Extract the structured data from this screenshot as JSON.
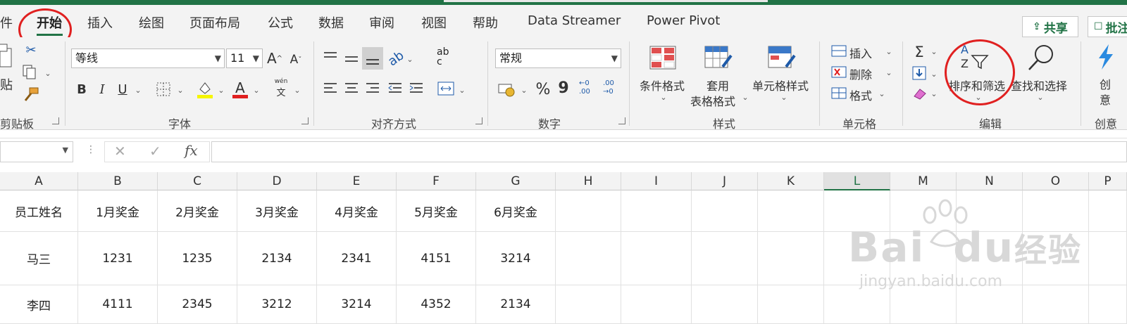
{
  "tabs": [
    "件",
    "开始",
    "插入",
    "绘图",
    "页面布局",
    "公式",
    "数据",
    "审阅",
    "视图",
    "帮助",
    "Data Streamer",
    "Power Pivot"
  ],
  "share_label": "共享",
  "comment_label": "批注",
  "clipboard": {
    "paste_label": "贴",
    "group_label": "剪贴板"
  },
  "font": {
    "name": "等线",
    "size": "11",
    "grow": "A",
    "shrink": "A",
    "bold": "B",
    "italic": "I",
    "underline": "U",
    "font_color_glyph": "A",
    "pinyin_top": "wén",
    "pinyin_bottom": "文",
    "group_label": "字体"
  },
  "alignment": {
    "wrap_top": "ab",
    "wrap_bottom": "c",
    "group_label": "对齐方式"
  },
  "number": {
    "format": "常规",
    "percent": "%",
    "comma": "9",
    "inc_decimal_top": "←0",
    "inc_decimal_bottom": ".00",
    "dec_decimal_top": ".00",
    "dec_decimal_bottom": "→0",
    "group_label": "数字"
  },
  "styles": {
    "conditional": "条件格式",
    "table_top": "套用",
    "table_bottom": "表格格式",
    "cell_styles": "单元格样式",
    "group_label": "样式"
  },
  "cells": {
    "insert": "插入",
    "delete": "删除",
    "format": "格式",
    "group_label": "单元格"
  },
  "editing": {
    "sigma": "Σ",
    "sort_az_top": "A",
    "sort_az_bottom": "Z",
    "sort_filter": "排序和筛选",
    "find_select": "查找和选择",
    "group_label": "编辑"
  },
  "creative": {
    "label_top": "创",
    "label_bottom": "意",
    "group_label": "创意"
  },
  "formula_bar": {
    "cancel": "✕",
    "enter": "✓",
    "fx": "fx"
  },
  "columns": [
    "A",
    "B",
    "C",
    "D",
    "E",
    "F",
    "G",
    "H",
    "I",
    "J",
    "K",
    "L",
    "M",
    "N",
    "O",
    "P"
  ],
  "rows": [
    [
      "员工姓名",
      "1月奖金",
      "2月奖金",
      "3月奖金",
      "4月奖金",
      "5月奖金",
      "6月奖金"
    ],
    [
      "马三",
      "1231",
      "1235",
      "2134",
      "2341",
      "4151",
      "3214"
    ],
    [
      "李四",
      "4111",
      "2345",
      "3212",
      "3214",
      "4352",
      "2134"
    ]
  ],
  "watermark": {
    "line1": "Bai",
    "line2": "du",
    "line3": "经验",
    "sub": "jingyan.baidu.com"
  },
  "colors": {
    "excel_green": "#217346",
    "annotation_red": "#e02020"
  }
}
